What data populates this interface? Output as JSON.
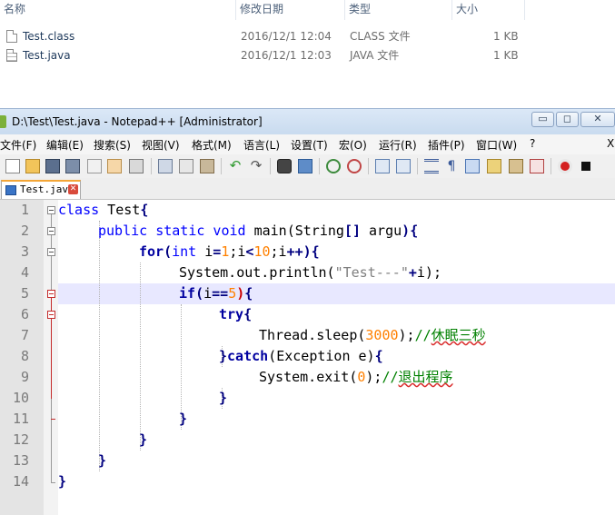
{
  "explorer": {
    "columns": {
      "name": "名称",
      "modified": "修改日期",
      "type": "类型",
      "size": "大小"
    },
    "files": [
      {
        "name": "Test.class",
        "modified": "2016/12/1 12:04",
        "type": "CLASS 文件",
        "size": "1 KB"
      },
      {
        "name": "Test.java",
        "modified": "2016/12/1 12:03",
        "type": "JAVA 文件",
        "size": "1 KB"
      }
    ]
  },
  "window": {
    "title": "D:\\Test\\Test.java - Notepad++ [Administrator]",
    "controls": {
      "minimize": "▭",
      "maximize": "◻",
      "close": "✕"
    }
  },
  "menu": [
    "文件(F)",
    "编辑(E)",
    "搜索(S)",
    "视图(V)",
    "格式(M)",
    "语言(L)",
    "设置(T)",
    "宏(O)",
    "运行(R)",
    "插件(P)",
    "窗口(W)",
    "?"
  ],
  "menu_close": "X",
  "toolbar_icons": [
    "new-file-icon",
    "open-file-icon",
    "save-icon",
    "save-all-icon",
    "close-icon",
    "close-all-icon",
    "print-icon",
    "cut-icon",
    "copy-icon",
    "paste-icon",
    "undo-icon",
    "redo-icon",
    "find-icon",
    "replace-icon",
    "zoom-in-icon",
    "zoom-out-icon",
    "sync-vertical-icon",
    "sync-horizontal-icon",
    "word-wrap-icon",
    "show-all-chars-icon",
    "indent-guide-icon",
    "user-lang-icon",
    "doc-map-icon",
    "function-list-icon",
    "record-macro-icon",
    "stop-record-icon"
  ],
  "tab": {
    "label": "Test.java",
    "close": "✕"
  },
  "editor": {
    "line_numbers": [
      "1",
      "2",
      "3",
      "4",
      "5",
      "6",
      "7",
      "8",
      "9",
      "10",
      "11",
      "12",
      "13",
      "14"
    ],
    "current_line": 5,
    "code": {
      "l1_kw": "class",
      "l1_rest": " Test",
      "l1_brace": "{",
      "l2_kw": "public static void",
      "l2_rest": " main(String",
      "l2_brk": "[]",
      "l2_rest2": " argu",
      "l2_paren": ")",
      "l2_brace": "{",
      "l3_kw": "for",
      "l3_p1": "(",
      "l3_type": "int",
      "l3_a": " i",
      "l3_eq": "=",
      "l3_n1": "1",
      "l3_s1": ";i",
      "l3_lt": "<",
      "l3_n2": "10",
      "l3_s2": ";i",
      "l3_pp": "++)",
      "l3_brace": "{",
      "l4_a": "System.out.println(",
      "l4_str": "\"Test---\"",
      "l4_plus": "+",
      "l4_b": "i);",
      "l5_kw": "if",
      "l5_p": "(",
      "l5_a": "i",
      "l5_eq": "==",
      "l5_n": "5",
      "l5_cp": ")",
      "l5_brace": "{",
      "l6_kw": "try",
      "l6_brace": "{",
      "l7_a": "Thread.sleep(",
      "l7_n": "3000",
      "l7_b": ");",
      "l7_cmt": "//",
      "l7_cmt2": "休眠三秒",
      "l8_brace": "}",
      "l8_kw": "catch",
      "l8_a": "(Exception e)",
      "l8_brace2": "{",
      "l9_a": "System.exit(",
      "l9_n": "0",
      "l9_b": ");",
      "l9_cmt": "//",
      "l9_cmt2": "退出程序",
      "l10": "}",
      "l11": "}",
      "l12": "}",
      "l13": "}",
      "l14": "}"
    }
  },
  "colors": {
    "keyword": "#0000ff",
    "number": "#ff8000",
    "comment": "#008000",
    "string": "#808080",
    "current_line": "#e8e8ff"
  }
}
